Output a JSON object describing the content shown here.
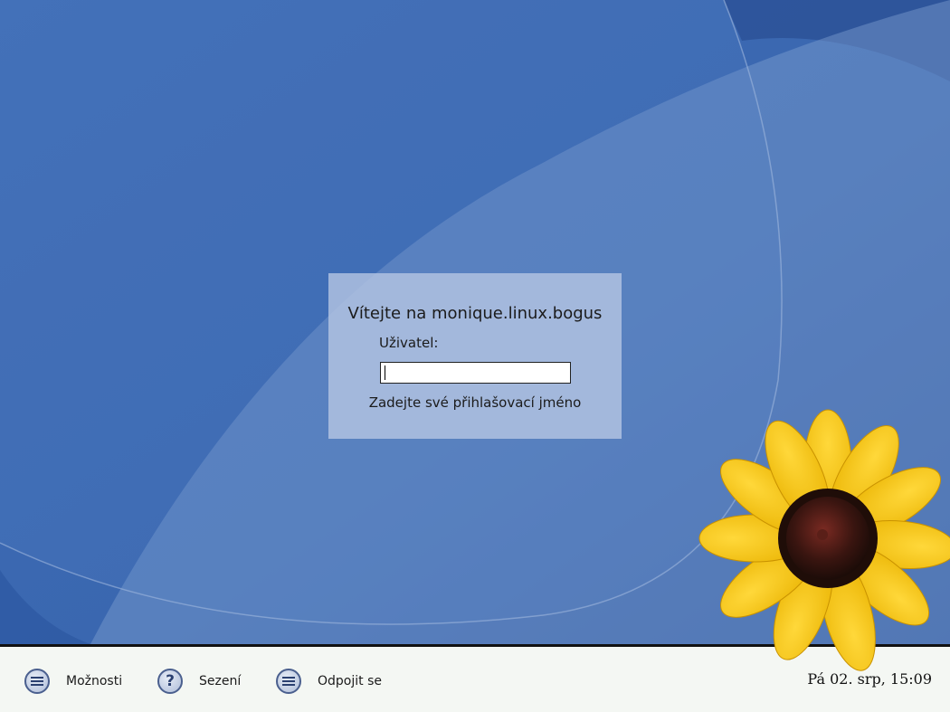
{
  "login": {
    "welcome": "Vítejte na monique.linux.bogus",
    "user_label": "Uživatel:",
    "username_value": "",
    "hint": "Zadejte své přihlašovací jméno"
  },
  "bottom_bar": {
    "options_label": "Možnosti",
    "session_label": "Sezení",
    "disconnect_label": "Odpojit se",
    "clock": "Pá 02. srp, 15:09"
  },
  "colors": {
    "background_blue": "#3a66ad",
    "bar_background": "#f4f7f3",
    "petal_yellow": "#f5c400",
    "flower_center": "#3a1a12"
  },
  "icons": {
    "options": "menu-list-icon",
    "session": "question-icon",
    "disconnect": "menu-list-icon"
  }
}
